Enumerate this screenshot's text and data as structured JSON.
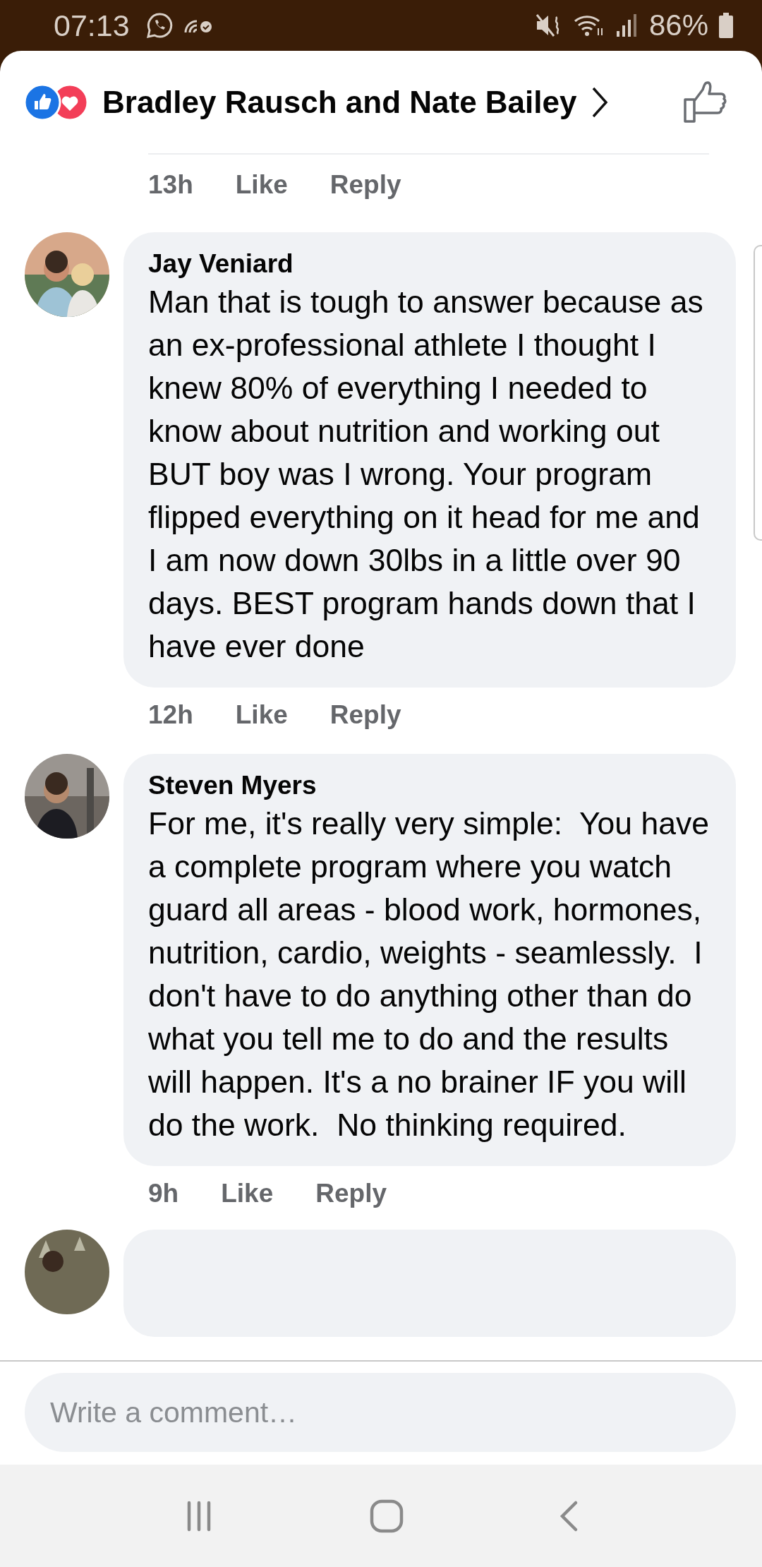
{
  "status_bar": {
    "time": "07:13",
    "battery": "86%"
  },
  "header": {
    "title": "Bradley Rausch and Nate Bailey"
  },
  "previous_meta": {
    "time": "13h",
    "like": "Like",
    "reply": "Reply"
  },
  "comments": [
    {
      "author": "Jay Veniard",
      "text": "Man that is tough to answer because as an ex-professional athlete I thought I knew 80% of everything I needed to know about nutrition and working out BUT boy was I wrong. Your program flipped everything on it head for me and I am now down 30lbs in a little over 90 days. BEST program hands down that I have ever done",
      "time": "12h",
      "like": "Like",
      "reply": "Reply"
    },
    {
      "author": "Steven Myers",
      "text": "For me, it's really very simple:  You have a complete program where you watch guard all areas - blood work, hormones, nutrition, cardio, weights - seamlessly.  I don't have to do anything other than do what you tell me to do and the results will happen. It's a no brainer IF you will do the work.  No thinking required.",
      "time": "9h",
      "like": "Like",
      "reply": "Reply"
    }
  ],
  "composer": {
    "placeholder": "Write a comment…"
  }
}
